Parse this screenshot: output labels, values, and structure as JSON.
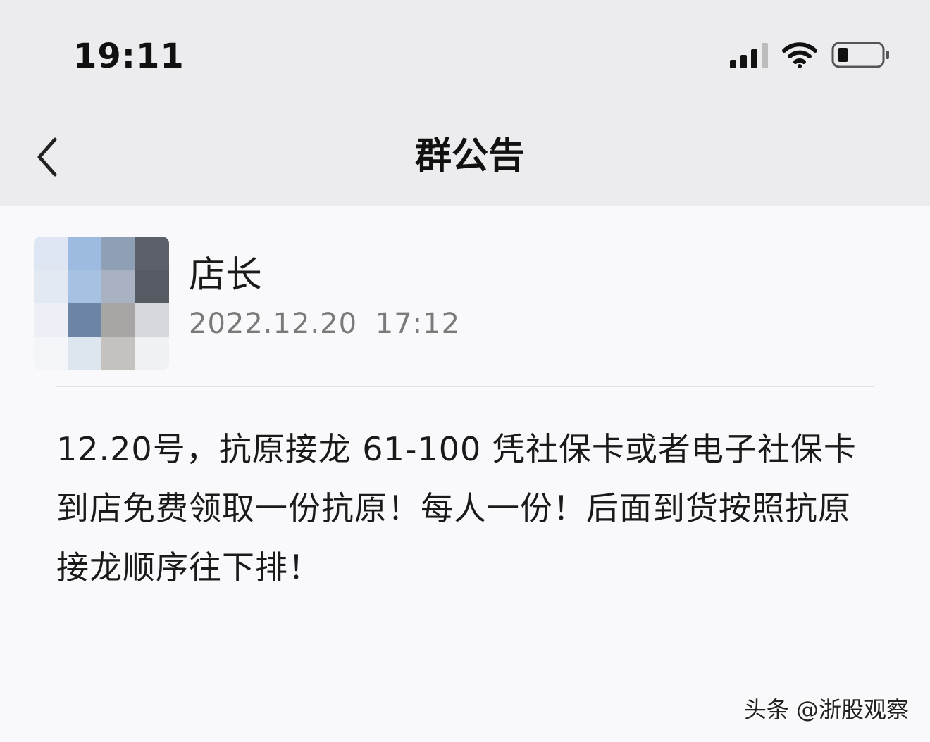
{
  "status_bar": {
    "time": "19:11"
  },
  "nav": {
    "back_icon": "chevron-left-icon",
    "title": "群公告"
  },
  "announcement": {
    "author": "店长",
    "timestamp": "2022.12.20 17:12",
    "body": "12.20号，抗原接龙 61-100 凭社保卡或者电子社保卡到店免费领取一份抗原！每人一份！后面到货按照抗原接龙顺序往下排！"
  },
  "avatar_colors": [
    "#dde6f2",
    "#9dbbe0",
    "#8fa0b6",
    "#5b6069",
    "#e3e9f2",
    "#a7c1e2",
    "#a8b2c2",
    "#565b63",
    "#ecf0f6",
    "#6c84a6",
    "#a7a6a4",
    "#d5d7dc",
    "#f3f5f8",
    "#dde5ef",
    "#c4c1be",
    "#f0f1f3"
  ],
  "colors": {
    "header_bg": "#ececee",
    "content_bg": "#f9f9fb",
    "muted_text": "#7a7a7a"
  },
  "watermark": "头条 @浙股观察"
}
